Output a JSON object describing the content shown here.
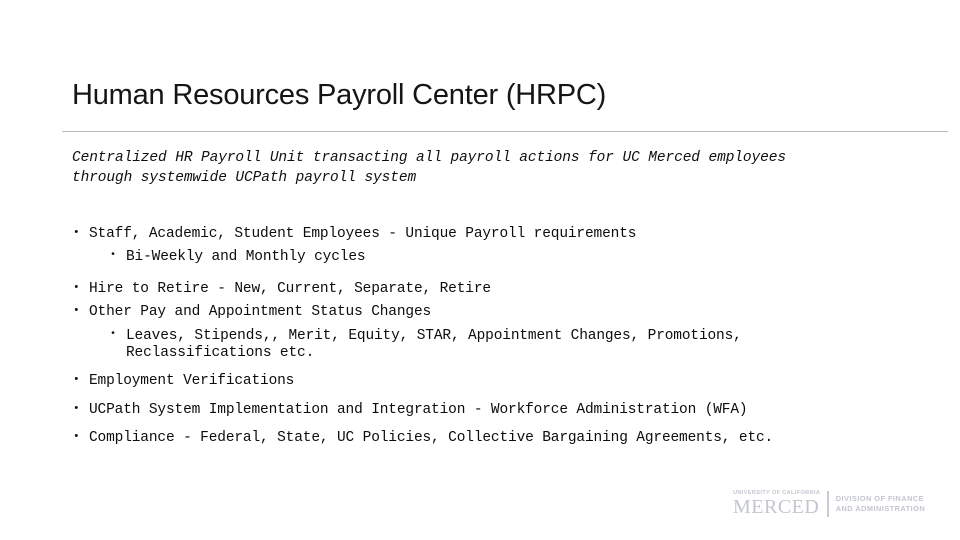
{
  "slide": {
    "title": "Human Resources Payroll Center (HRPC)",
    "subtitle": {
      "line1": "Centralized HR Payroll Unit transacting all payroll actions for UC Merced employees",
      "line2": "through systemwide UCPath payroll system"
    },
    "bullets": [
      {
        "level": 1,
        "text": "Staff, Academic, Student Employees - Unique Payroll requirements"
      },
      {
        "level": 2,
        "text": "Bi-Weekly and Monthly cycles"
      },
      {
        "level": 1,
        "text": "Hire to Retire - New, Current, Separate, Retire"
      },
      {
        "level": 1,
        "text": "Other Pay and Appointment Status Changes"
      },
      {
        "level": 2,
        "text_line1": "Leaves, Stipends,, Merit, Equity, STAR, Appointment Changes, Promotions,",
        "text_line2": "Reclassifications etc."
      },
      {
        "level": 1,
        "text": "Employment Verifications"
      },
      {
        "level": 1,
        "text": "UCPath System Implementation and Integration - Workforce Administration (WFA)"
      },
      {
        "level": 1,
        "text": "Compliance - Federal, State, UC Policies, Collective Bargaining Agreements, etc."
      }
    ]
  },
  "footer": {
    "logo": {
      "university_line": "UNIVERSITY OF CALIFORNIA",
      "campus": "MERCED",
      "division_line1": "DIVISION OF FINANCE",
      "division_line2": "AND ADMINISTRATION"
    }
  },
  "colors": {
    "background": "#ffffff",
    "title_text": "#151515",
    "body_text": "#0d0d0d",
    "rule": "#b9b9b9",
    "logo": "#c3c6cf"
  }
}
